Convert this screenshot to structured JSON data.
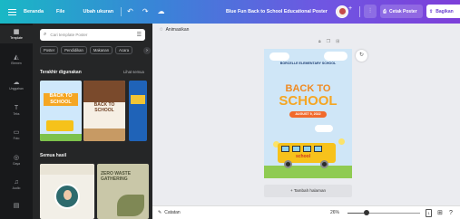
{
  "topbar": {
    "home": "Beranda",
    "file": "File",
    "resize": "Ubah ukuran",
    "title": "Blue Fun Back to School Educational Poster",
    "print": "Cetak Poster",
    "share": "Bagikan",
    "plus_icon": "plus-icon",
    "chart_icon": "chart-icon"
  },
  "rail": {
    "items": [
      {
        "label": "Template",
        "icon": "template-icon",
        "active": true
      },
      {
        "label": "Elemen",
        "icon": "elements-icon"
      },
      {
        "label": "Unggahan",
        "icon": "upload-icon"
      },
      {
        "label": "Teks",
        "icon": "text-icon"
      },
      {
        "label": "Foto",
        "icon": "photo-icon"
      },
      {
        "label": "Gaya",
        "icon": "styles-icon"
      },
      {
        "label": "Audio",
        "icon": "audio-icon"
      },
      {
        "label": "",
        "icon": "more-icon"
      }
    ]
  },
  "panel": {
    "search_placeholder": "Cari template Poster",
    "chips": [
      "Poster",
      "Pendidikan",
      "Makanan",
      "Acara"
    ],
    "recent_title": "Terakhir digunakan",
    "see_all": "Lihat semua",
    "all_results_title": "Semua hasil",
    "thumb1": {
      "line1": "BACK TO",
      "line2": "SCHOOL"
    },
    "thumb2": {
      "line1": "BACK TO",
      "line2": "SCHOOL"
    },
    "thumb5": {
      "title": "ZERO WASTE GATHERING"
    }
  },
  "canvas": {
    "animate": "Animasikan",
    "poster": {
      "org": "BORCELLE ELEMENTARY SCHOOL",
      "line1": "BACK TO",
      "line2": "SCHOOL",
      "date": "AUGUST 9, 2022",
      "bus_label": "school"
    },
    "add_page": "+ Tambah halaman"
  },
  "bottombar": {
    "notes": "Catatan",
    "zoom": "26%",
    "zoom_fraction": 0.26,
    "page_count": "1"
  }
}
